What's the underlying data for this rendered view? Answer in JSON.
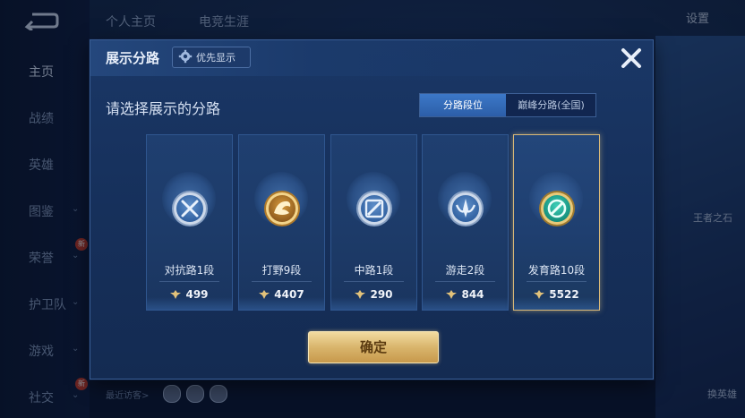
{
  "nav": {
    "items": [
      {
        "label": "主页",
        "has_chevron": false,
        "new": false
      },
      {
        "label": "战绩",
        "has_chevron": false,
        "new": false
      },
      {
        "label": "英雄",
        "has_chevron": false,
        "new": false
      },
      {
        "label": "图鉴",
        "has_chevron": true,
        "new": false
      },
      {
        "label": "荣誉",
        "has_chevron": true,
        "new": true
      },
      {
        "label": "护卫队",
        "has_chevron": true,
        "new": false
      },
      {
        "label": "游戏",
        "has_chevron": true,
        "new": false
      },
      {
        "label": "社交",
        "has_chevron": true,
        "new": true
      }
    ],
    "new_badge": "新",
    "chevron_icon": "chevron-down-icon",
    "back_icon": "back-arrow-icon"
  },
  "top": {
    "tabs": [
      "个人主页",
      "电竞生涯"
    ],
    "settings_label": "设置"
  },
  "footer": {
    "visitors_label": "最近访客>"
  },
  "right_panel": {
    "labels": [
      "王者之石",
      "换英雄"
    ]
  },
  "dialog": {
    "title": "展示分路",
    "priority_label": "优先显示",
    "priority_icon": "gear-icon",
    "close_icon": "close-icon",
    "subtitle": "请选择展示的分路",
    "segments": [
      {
        "label": "分路段位",
        "active": true
      },
      {
        "label": "巅峰分路(全国)",
        "active": false
      }
    ],
    "lanes": [
      {
        "name": "对抗路1段",
        "points": "499",
        "icon": "clash-lane-icon",
        "selected": false,
        "palette": "silver"
      },
      {
        "name": "打野9段",
        "points": "4407",
        "icon": "jungle-dragon-icon",
        "selected": false,
        "palette": "gold"
      },
      {
        "name": "中路1段",
        "points": "290",
        "icon": "mid-lane-icon",
        "selected": false,
        "palette": "silver"
      },
      {
        "name": "游走2段",
        "points": "844",
        "icon": "roam-lane-icon",
        "selected": false,
        "palette": "silver"
      },
      {
        "name": "发育路10段",
        "points": "5522",
        "icon": "farm-lane-icon",
        "selected": true,
        "palette": "jade"
      }
    ],
    "points_icon": "points-coin-icon",
    "confirm_label": "确定"
  },
  "colors": {
    "accent_blue": "#2c5ea8",
    "selected_border": "#d9b978",
    "confirm_gold": "#d9b56c"
  }
}
